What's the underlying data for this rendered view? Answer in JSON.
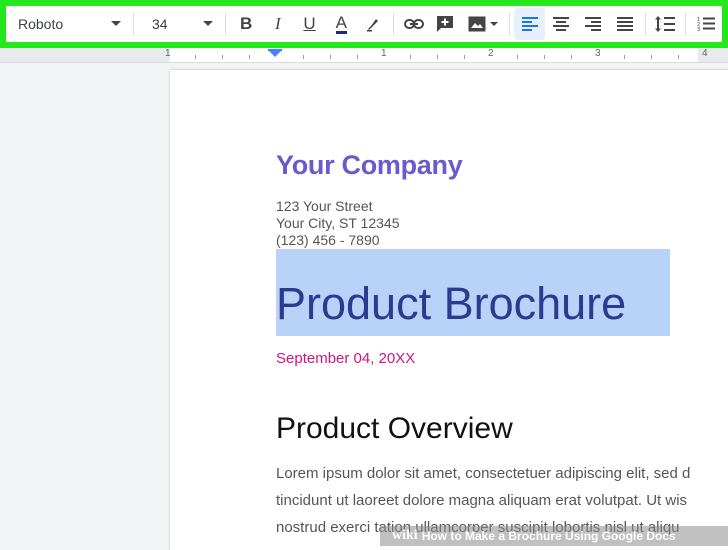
{
  "toolbar": {
    "font_family": "Roboto",
    "font_size": "34",
    "buttons": [
      {
        "name": "bold-button",
        "label": "B"
      },
      {
        "name": "italic-button",
        "label": "I"
      },
      {
        "name": "underline-button",
        "label": "U"
      },
      {
        "name": "text-color-button",
        "label": "A"
      }
    ],
    "text_color": "#1a2b8c",
    "highlight_border_color": "#22e81c"
  },
  "ruler": {
    "labels": [
      "1",
      "1",
      "2",
      "3",
      "4"
    ]
  },
  "document": {
    "company": "Your Company",
    "address_lines": [
      "123 Your Street",
      "Your City, ST 12345",
      "(123) 456 - 7890"
    ],
    "title": "Product Brochure",
    "date": "September 04, 20XX",
    "section_title": "Product Overview",
    "body_lines": [
      "Lorem ipsum dolor sit amet, consectetuer adipiscing elit, sed d",
      "tincidunt ut laoreet dolore magna aliquam erat volutpat. Ut wis",
      "nostrud exerci tation ullamcorper suscipit lobortis nisl ut aliqu"
    ]
  },
  "watermark": {
    "brand": "wiki",
    "text": "How to Make a Brochure Using Google Docs"
  }
}
